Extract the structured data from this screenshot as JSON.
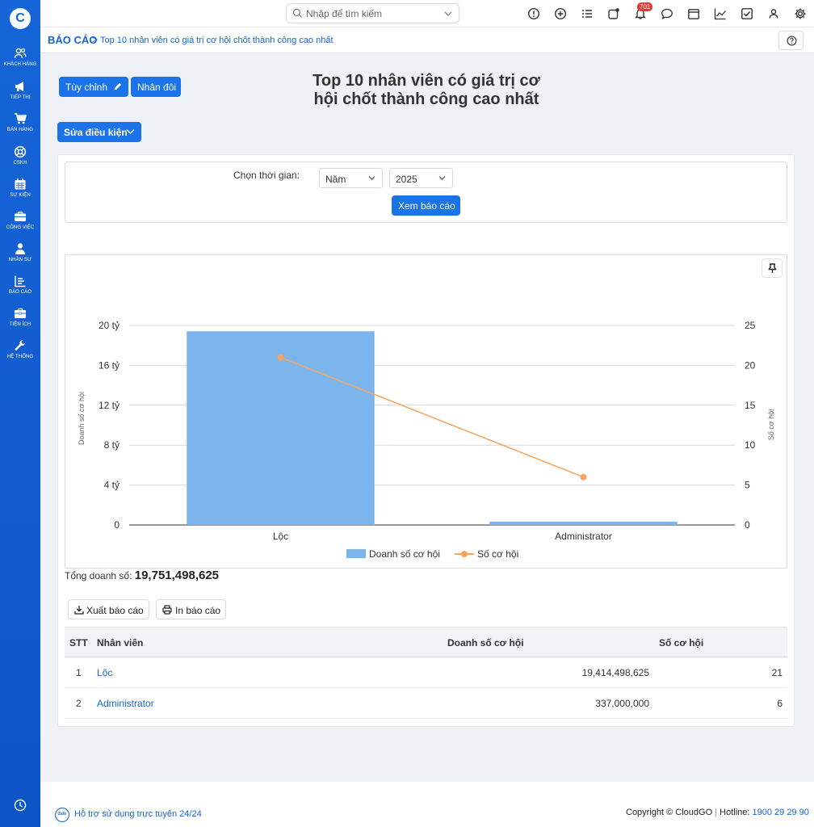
{
  "sidebar": {
    "logo": "C",
    "items": [
      {
        "label": "KHÁCH HÀNG",
        "icon": "customers-icon"
      },
      {
        "label": "TIẾP THỊ",
        "icon": "megaphone-icon"
      },
      {
        "label": "BÁN HÀNG",
        "icon": "cart-icon"
      },
      {
        "label": "CSKH",
        "icon": "lifebuoy-icon"
      },
      {
        "label": "SỰ KIỆN",
        "icon": "calendar-icon"
      },
      {
        "label": "CÔNG VIỆC",
        "icon": "briefcase-icon"
      },
      {
        "label": "NHÂN SỰ",
        "icon": "person-icon"
      },
      {
        "label": "BÁO CÁO",
        "icon": "report-icon"
      },
      {
        "label": "TIỆN ÍCH",
        "icon": "toolbox-icon"
      },
      {
        "label": "HỆ THỐNG",
        "icon": "wrench-icon"
      }
    ]
  },
  "topbar": {
    "search_placeholder": "Nhập để tìm kiếm",
    "notification_count": "701"
  },
  "breadcrumb": {
    "root": "BÁO CÁO",
    "separator": ">",
    "current": "Top 10 nhân viên có giá trị cơ hội chốt thành công cao nhất"
  },
  "toolbar": {
    "customize_label": "Tùy chỉnh",
    "duplicate_label": "Nhân đôi",
    "edit_conditions_label": "Sửa điều kiện"
  },
  "report": {
    "title_line1": "Top 10 nhân viên có giá trị cơ",
    "title_line2": "hội chốt thành công cao nhất"
  },
  "filter": {
    "label": "Chọn thời gian:",
    "period": "Năm",
    "year": "2025",
    "view_button": "Xem báo cáo"
  },
  "chart_data": {
    "type": "bar",
    "categories": [
      "Lộc",
      "Administrator"
    ],
    "series": [
      {
        "name": "Doanh số cơ hội",
        "type": "bar",
        "axis": "left",
        "values": [
          19414498625,
          337000000
        ],
        "color": "#7cb5ec"
      },
      {
        "name": "Số cơ hội",
        "type": "line",
        "axis": "right",
        "values": [
          21,
          6
        ],
        "color": "#f7a35c"
      }
    ],
    "ylabel": "Doanh số cơ hội",
    "y2label": "Số cơ hội",
    "ylim": [
      0,
      20000000000
    ],
    "y2lim": [
      0,
      25
    ],
    "y_ticks": [
      "0",
      "4 tỷ",
      "8 tỷ",
      "12 tỷ",
      "16 tỷ",
      "20 tỷ"
    ],
    "y2_ticks": [
      "0",
      "5",
      "10",
      "15",
      "20",
      "25"
    ],
    "grid": true,
    "legend": "bottom-center"
  },
  "summary": {
    "total_label": "Tổng doanh số:",
    "total_value": "19,751,498,625"
  },
  "actions": {
    "export_label": "Xuất báo cáo",
    "print_label": "In báo cáo"
  },
  "table": {
    "headers": [
      "STT",
      "Nhân viên",
      "Doanh số cơ hội",
      "Số cơ hội"
    ],
    "rows": [
      {
        "stt": "1",
        "name": "Lộc",
        "revenue": "19,414,498,625",
        "count": "21"
      },
      {
        "stt": "2",
        "name": "Administrator",
        "revenue": "337,000,000",
        "count": "6"
      }
    ]
  },
  "footer": {
    "support_text": "Hỗ trợ sử dụng trực tuyến 24/24",
    "zalo": "Zalo",
    "copyright": "Copyright © CloudGO",
    "hotline_label": "Hotline:",
    "hotline": "1900 29 29 90"
  },
  "colors": {
    "primary": "#1a73e8",
    "sidebar": "#1565d8",
    "bar": "#7cb5ec",
    "line": "#f7a35c"
  }
}
